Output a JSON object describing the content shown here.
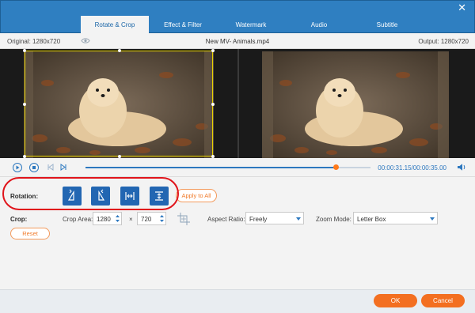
{
  "window": {
    "close_label": "✕"
  },
  "tabs": [
    {
      "label": "Rotate & Crop",
      "active": true
    },
    {
      "label": "Effect & Filter"
    },
    {
      "label": "Watermark"
    },
    {
      "label": "Audio"
    },
    {
      "label": "Subtitle"
    }
  ],
  "preview": {
    "original_label": "Original: 1280x720",
    "file_name": "New MV- Animals.mp4",
    "output_label": "Output: 1280x720"
  },
  "playback": {
    "time": "00:00:31.15/00:00:35.00",
    "progress": 0.88
  },
  "rotation": {
    "label": "Rotation:",
    "buttons": [
      {
        "icon": "rotate-left-icon"
      },
      {
        "icon": "rotate-right-icon"
      },
      {
        "icon": "flip-horizontal-icon"
      },
      {
        "icon": "flip-vertical-icon"
      }
    ],
    "apply_label": "Apply to All"
  },
  "crop": {
    "label": "Crop:",
    "area_label": "Crop Area:",
    "width": "1280",
    "height": "720",
    "times": "×",
    "aspect_label": "Aspect Ratio:",
    "aspect_value": "Freely",
    "zoom_label": "Zoom Mode:",
    "zoom_value": "Letter Box",
    "reset_label": "Reset"
  },
  "footer": {
    "ok_label": "OK",
    "cancel_label": "Cancel"
  },
  "colors": {
    "accent": "#2f7fc1",
    "orange": "#f36f21",
    "crop_frame": "#e9d400",
    "annotation": "#e0141b"
  }
}
